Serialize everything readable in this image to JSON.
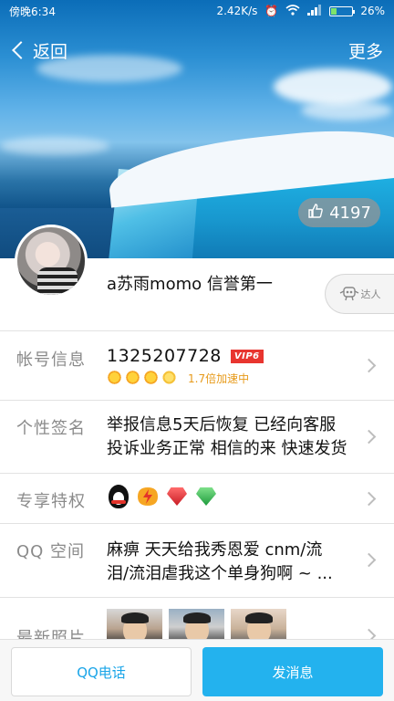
{
  "status_bar": {
    "time": "傍晚6:34",
    "net_speed": "2.42K/s",
    "battery_percent": "26%",
    "battery_level": 0.26,
    "battery_color": "#7ee36a"
  },
  "nav": {
    "back_label": "返回",
    "more_label": "更多"
  },
  "likes": {
    "count": "4197",
    "icon": "thumbs-up-icon"
  },
  "profile": {
    "nickname": "a苏雨momo  信誉第一",
    "talent_label": "达人"
  },
  "rows": {
    "account": {
      "label": "帐号信息",
      "number": "1325207728",
      "vip_badge": "VIP6",
      "speed_text": "1.7倍加速中",
      "level_icons": [
        "sun-icon",
        "sun-icon",
        "sun-icon",
        "sun-icon"
      ]
    },
    "signature": {
      "label": "个性签名",
      "line1": "举报信息5天后恢复 已经向客服",
      "line2": "投诉业务正常 相信的来 快速发货"
    },
    "privileges": {
      "label": "专享特权",
      "icons": [
        "qq-penguin-icon",
        "lightning-icon",
        "red-diamond-icon",
        "green-diamond-icon"
      ]
    },
    "qzone": {
      "label": "QQ 空间",
      "line1": "麻痹  天天给我秀恩爱  cnm/流",
      "line2": "泪/流泪虐我这个单身狗啊 ~ ..."
    },
    "photos": {
      "label": "最新照片"
    }
  },
  "bottom": {
    "call_label": "QQ电话",
    "message_label": "发消息"
  },
  "colors": {
    "accent": "#23b2ee",
    "vip_red": "#e8352f",
    "speed_orange": "#e79a1a"
  }
}
